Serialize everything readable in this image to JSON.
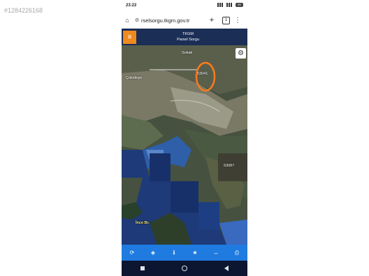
{
  "watermark": "#1284226168",
  "status": {
    "time": "23:22",
    "battery": "85"
  },
  "browser": {
    "url": "rselsorgu.tkgm.gov.tr",
    "tab_count": "1"
  },
  "app": {
    "org": "TKGM",
    "title": "Parsel Sorgu",
    "menu_icon": "hamburger-icon"
  },
  "map": {
    "labels": {
      "top_street": "Sokak",
      "cokek_label": "Çokeleşe",
      "parcel_label": "53041",
      "right_tile": "53087",
      "ince_burun": "İnce Br."
    },
    "highlight_color": "#ff7a1a"
  },
  "toolbar": [
    "refresh-icon",
    "locate-icon",
    "info-icon",
    "star-icon",
    "measure-icon",
    "print-icon"
  ],
  "colors": {
    "header": "#1b2e55",
    "menu_button": "#ef8a1f",
    "toolbar": "#1f7be0",
    "navbar": "#0c1630"
  }
}
